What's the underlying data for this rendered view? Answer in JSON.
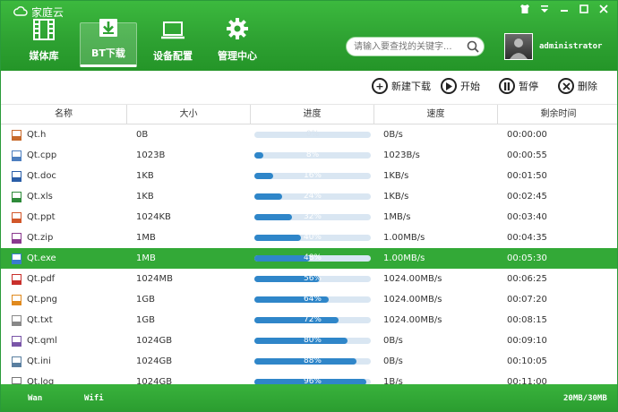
{
  "app": {
    "title": "家庭云"
  },
  "window": {
    "skin_icon": "shirt-icon",
    "menu_icon": "dropdown-menu-icon"
  },
  "nav": [
    {
      "label": "媒体库",
      "icon": "film-icon"
    },
    {
      "label": "BT下载",
      "icon": "download-icon",
      "active": true
    },
    {
      "label": "设备配置",
      "icon": "monitor-icon"
    },
    {
      "label": "管理中心",
      "icon": "gear-icon"
    }
  ],
  "search": {
    "placeholder": "请输入要查找的关键字..."
  },
  "user": {
    "name": "administrator"
  },
  "toolbar": {
    "new_download": "新建下载",
    "start": "开始",
    "pause": "暂停",
    "delete": "删除"
  },
  "table": {
    "headers": [
      "名称",
      "大小",
      "进度",
      "速度",
      "剩余时间"
    ],
    "rows": [
      {
        "name": "Qt.h",
        "size": "0B",
        "progress": 0,
        "progress_label": "0%",
        "speed": "0B/s",
        "remaining": "00:00:00",
        "icon_color": "#c76a2b"
      },
      {
        "name": "Qt.cpp",
        "size": "1023B",
        "progress": 8,
        "progress_label": "8%",
        "speed": "1023B/s",
        "remaining": "00:00:55",
        "icon_color": "#4d7fbf"
      },
      {
        "name": "Qt.doc",
        "size": "1KB",
        "progress": 16,
        "progress_label": "16%",
        "speed": "1KB/s",
        "remaining": "00:01:50",
        "icon_color": "#2b5ea8"
      },
      {
        "name": "Qt.xls",
        "size": "1KB",
        "progress": 24,
        "progress_label": "24%",
        "speed": "1KB/s",
        "remaining": "00:02:45",
        "icon_color": "#2e8b3a"
      },
      {
        "name": "Qt.ppt",
        "size": "1024KB",
        "progress": 32,
        "progress_label": "32%",
        "speed": "1MB/s",
        "remaining": "00:03:40",
        "icon_color": "#d2572a"
      },
      {
        "name": "Qt.zip",
        "size": "1MB",
        "progress": 40,
        "progress_label": "40%",
        "speed": "1.00MB/s",
        "remaining": "00:04:35",
        "icon_color": "#8b3a8f"
      },
      {
        "name": "Qt.exe",
        "size": "1MB",
        "progress": 48,
        "progress_label": "48%",
        "speed": "1.00MB/s",
        "remaining": "00:05:30",
        "icon_color": "#3a7ccf",
        "selected": true
      },
      {
        "name": "Qt.pdf",
        "size": "1024MB",
        "progress": 56,
        "progress_label": "56%",
        "speed": "1024.00MB/s",
        "remaining": "00:06:25",
        "icon_color": "#c9302c"
      },
      {
        "name": "Qt.png",
        "size": "1GB",
        "progress": 64,
        "progress_label": "64%",
        "speed": "1024.00MB/s",
        "remaining": "00:07:20",
        "icon_color": "#e08a1e"
      },
      {
        "name": "Qt.txt",
        "size": "1GB",
        "progress": 72,
        "progress_label": "72%",
        "speed": "1024.00MB/s",
        "remaining": "00:08:15",
        "icon_color": "#888888"
      },
      {
        "name": "Qt.qml",
        "size": "1024GB",
        "progress": 80,
        "progress_label": "80%",
        "speed": "0B/s",
        "remaining": "00:09:10",
        "icon_color": "#7a55a8"
      },
      {
        "name": "Qt.ini",
        "size": "1024GB",
        "progress": 88,
        "progress_label": "88%",
        "speed": "0B/s",
        "remaining": "00:10:05",
        "icon_color": "#5a7fa0"
      },
      {
        "name": "Qt.log",
        "size": "1024GB",
        "progress": 96,
        "progress_label": "96%",
        "speed": "1B/s",
        "remaining": "00:11:00",
        "icon_color": "#777777"
      }
    ]
  },
  "status": {
    "wan": "Wan",
    "wifi": "Wifi",
    "capacity": "20MB/30MB"
  }
}
